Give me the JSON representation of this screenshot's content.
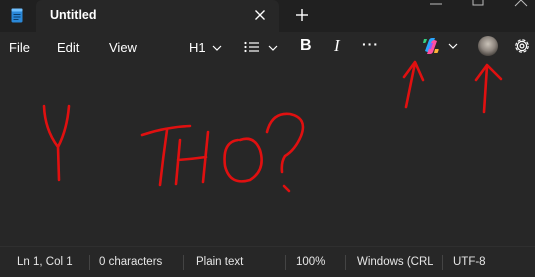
{
  "tab": {
    "title": "Untitled"
  },
  "menu": {
    "file": "File",
    "edit": "Edit",
    "view": "View"
  },
  "toolbar": {
    "heading": "H1",
    "more": "···",
    "bold_glyph": "B",
    "italic_glyph": "I"
  },
  "editor": {
    "ink_color": "#e01010"
  },
  "status": {
    "position": "Ln 1, Col 1",
    "characters": "0 characters",
    "format": "Plain text",
    "zoom": "100%",
    "line_ending": "Windows (CRL",
    "encoding": "UTF-8"
  },
  "colors": {
    "background": "#272727",
    "titlebar": "#202020",
    "text": "#ffffff",
    "ink": "#e01010"
  },
  "icons": [
    "notepad-icon",
    "close-icon",
    "plus-icon",
    "list-icon",
    "chevron-down-icon",
    "copilot-icon",
    "avatar",
    "gear-icon"
  ]
}
